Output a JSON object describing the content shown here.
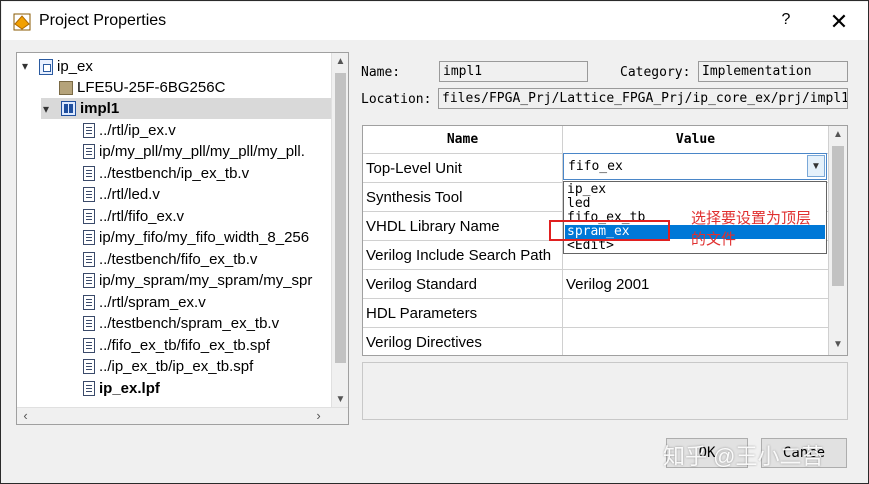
{
  "window": {
    "title": "Project Properties",
    "help": "?",
    "close": "✕"
  },
  "tree": {
    "items": [
      {
        "label": "ip_ex"
      },
      {
        "label": "LFE5U-25F-6BG256C"
      },
      {
        "label": "impl1"
      },
      {
        "label": "../rtl/ip_ex.v"
      },
      {
        "label": "ip/my_pll/my_pll/my_pll/my_pll."
      },
      {
        "label": "../testbench/ip_ex_tb.v"
      },
      {
        "label": "../rtl/led.v"
      },
      {
        "label": "../rtl/fifo_ex.v"
      },
      {
        "label": "ip/my_fifo/my_fifo_width_8_256"
      },
      {
        "label": "../testbench/fifo_ex_tb.v"
      },
      {
        "label": "ip/my_spram/my_spram/my_spr"
      },
      {
        "label": "../rtl/spram_ex.v"
      },
      {
        "label": "../testbench/spram_ex_tb.v"
      },
      {
        "label": "../fifo_ex_tb/fifo_ex_tb.spf"
      },
      {
        "label": "../ip_ex_tb/ip_ex_tb.spf"
      },
      {
        "label": "ip_ex.lpf"
      }
    ]
  },
  "fields": {
    "name_label": "Name:",
    "name_value": "impl1",
    "category_label": "Category:",
    "category_value": "Implementation",
    "location_label": "Location:",
    "location_value": "files/FPGA_Prj/Lattice_FPGA_Prj/ip_core_ex/prj/impl1"
  },
  "grid": {
    "col_name": "Name",
    "col_value": "Value",
    "rows": [
      {
        "name": "Top-Level Unit",
        "value": "fifo_ex"
      },
      {
        "name": "Synthesis Tool",
        "value": ""
      },
      {
        "name": "VHDL Library Name",
        "value": ""
      },
      {
        "name": "Verilog Include Search Path",
        "value": ""
      },
      {
        "name": "Verilog Standard",
        "value": "Verilog 2001"
      },
      {
        "name": "HDL Parameters",
        "value": ""
      },
      {
        "name": "Verilog Directives",
        "value": ""
      }
    ]
  },
  "dropdown": {
    "options": [
      "ip_ex",
      "led",
      "fifo_ex_tb",
      "spram_ex",
      "<Edit>"
    ],
    "selected": "spram_ex"
  },
  "annotation": {
    "line1": "选择要设置为顶层",
    "line2": "的文件"
  },
  "buttons": {
    "ok": "OK",
    "cancel": "Cance"
  },
  "watermark": "知乎 @王小二苔",
  "colors": {
    "selection": "#0078d7",
    "annotation": "#e03030"
  }
}
